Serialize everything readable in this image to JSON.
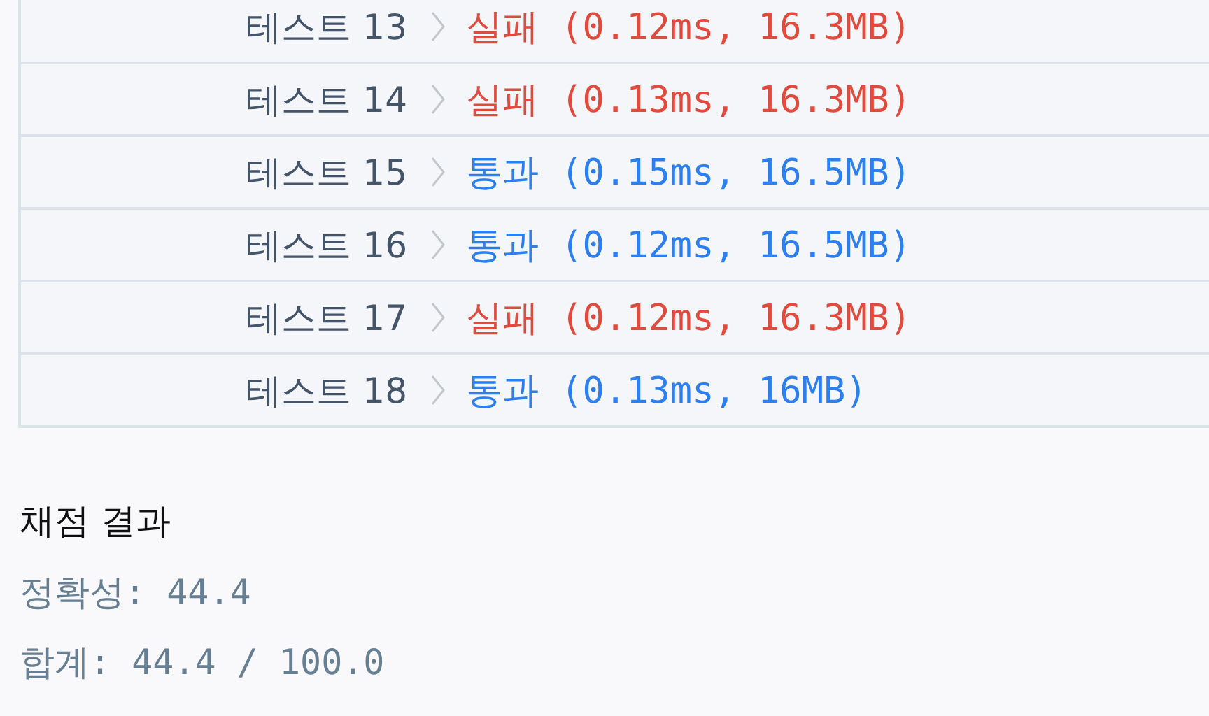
{
  "tests": [
    {
      "label": "테스트 13",
      "result": "실패 (0.12ms, 16.3MB)",
      "passed": false
    },
    {
      "label": "테스트 14",
      "result": "실패 (0.13ms, 16.3MB)",
      "passed": false
    },
    {
      "label": "테스트 15",
      "result": "통과 (0.15ms, 16.5MB)",
      "passed": true
    },
    {
      "label": "테스트 16",
      "result": "통과 (0.12ms, 16.5MB)",
      "passed": true
    },
    {
      "label": "테스트 17",
      "result": "실패 (0.12ms, 16.3MB)",
      "passed": false
    },
    {
      "label": "테스트 18",
      "result": "통과 (0.13ms, 16MB)",
      "passed": true
    }
  ],
  "summary": {
    "title": "채점 결과",
    "lines": [
      "정확성: 44.4",
      "합계: 44.4 / 100.0"
    ]
  }
}
